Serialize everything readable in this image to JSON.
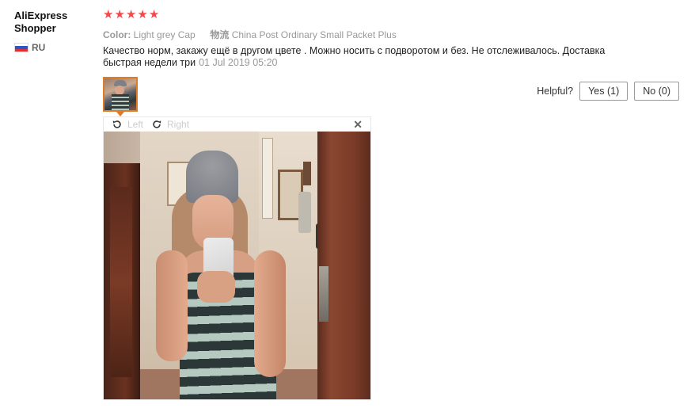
{
  "user": {
    "name": "AliExpress Shopper",
    "country": "RU"
  },
  "review": {
    "rating": 5,
    "stars": [
      "★",
      "★",
      "★",
      "★",
      "★"
    ],
    "color_label": "Color:",
    "color_value": "Light grey Cap",
    "shipping_label": "物流",
    "shipping_value": "China Post Ordinary Small Packet Plus",
    "text": "Качество норм, закажу ещё в другом цвете . Можно носить с подворотом и без. Не отслеживалось. Доставка быстрая недели три",
    "date": "01 Jul 2019 05:20"
  },
  "helpful": {
    "label": "Helpful?",
    "yes": "Yes (1)",
    "no": "No (0)"
  },
  "viewer": {
    "rotate_left": "Left",
    "rotate_right": "Right",
    "close": "✕"
  },
  "colors": {
    "stars": "#f5484a",
    "thumb_border": "#e07b28"
  }
}
